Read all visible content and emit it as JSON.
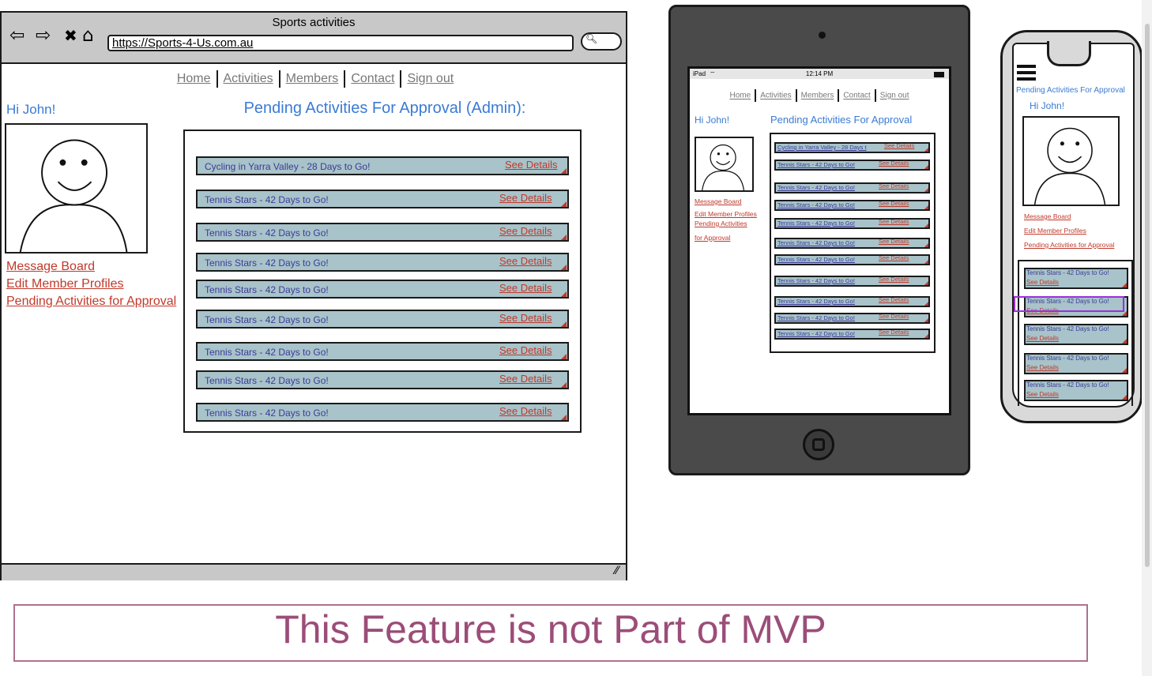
{
  "desktop": {
    "window_title": "Sports activities",
    "url": "https://Sports-4-Us.com.au",
    "nav": [
      "Home",
      "Activities",
      "Members",
      "Contact",
      "Sign out"
    ],
    "greeting": "Hi John!",
    "heading": "Pending Activities For Approval (Admin):",
    "links": [
      "Message Board",
      "Edit Member Profiles",
      "Pending Activities for Approval"
    ],
    "see_details": "See Details",
    "rows": [
      "Cycling in Yarra Valley - 28 Days to Go!",
      "Tennis Stars - 42 Days to Go!",
      "Tennis Stars - 42 Days to Go!",
      "Tennis Stars - 42 Days to Go!",
      "Tennis Stars - 42 Days to Go!",
      "Tennis Stars - 42 Days to Go!",
      "Tennis Stars - 42 Days to Go!",
      "Tennis Stars - 42 Days to Go!",
      "Tennis Stars - 42 Days to Go!"
    ]
  },
  "tablet": {
    "status_left": "iPad",
    "status_time": "12:14 PM",
    "nav": [
      "Home",
      "Activities",
      "Members",
      "Contact",
      "Sign out"
    ],
    "greeting": "Hi John!",
    "heading": "Pending Activities For Approval",
    "links": [
      "Message Board",
      "Edit Member Profiles",
      "Pending Activities",
      "for Approval"
    ],
    "see_details": "See Details",
    "rows": [
      "Cycling in Yarra Valley - 28 Days t",
      "Tennis Stars - 42 Days to Go!",
      "Tennis Stars - 42 Days to Go!",
      "Tennis Stars - 42 Days to Go!",
      "Tennis Stars - 42 Days to Go!",
      "Tennis Stars - 42 Days to Go!",
      "Tennis Stars - 42 Days to Go!",
      "Tennis Stars - 42 Days to Go!",
      "Tennis Stars - 42 Days to Go!",
      "Tennis Stars - 42 Days to Go!",
      "Tennis Stars - 42 Days to Go!"
    ]
  },
  "phone": {
    "heading": "Pending Activities For Approval",
    "greeting": "Hi John!",
    "links": [
      "Message Board",
      "Edit Member Profiles",
      "Pending Activities for Approval"
    ],
    "see_details": "See Details",
    "rows": [
      "Tennis Stars - 42 Days to Go!",
      "Tennis Stars - 42 Days to Go!",
      "Tennis Stars - 42 Days to Go!",
      "Tennis Stars - 42 Days to Go!",
      "Tennis Stars - 42 Days to Go!"
    ]
  },
  "banner": "This Feature is not Part of MVP"
}
